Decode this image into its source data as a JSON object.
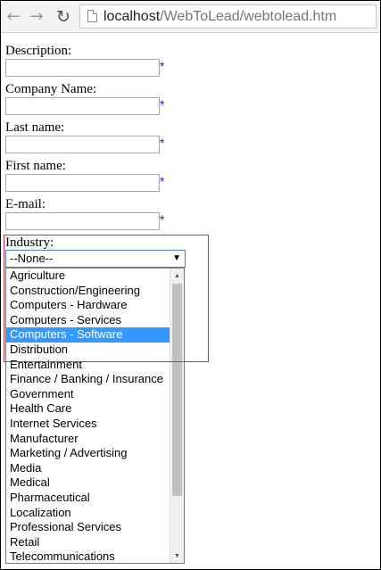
{
  "browser": {
    "icons": {
      "back": "arrow-left-icon",
      "forward": "arrow-right-icon",
      "reload": "reload-icon",
      "page": "page-icon"
    },
    "url_host": "localhost",
    "url_path": "/WebToLead/webtolead.htm"
  },
  "form": {
    "fields": [
      {
        "label": "Description:",
        "value": "",
        "required_mark": "*"
      },
      {
        "label": "Company Name:",
        "value": "",
        "required_mark": "*"
      },
      {
        "label": "Last name:",
        "value": "",
        "required_mark": "*"
      },
      {
        "label": "First name:",
        "value": "",
        "required_mark": "*"
      },
      {
        "label": "E-mail:",
        "value": "",
        "required_mark": "*"
      }
    ],
    "industry": {
      "label": "Industry:",
      "selected_value": "--None--",
      "highlighted_option": "Computers - Software",
      "options": [
        "Agriculture",
        "Construction/Engineering",
        "Computers - Hardware",
        "Computers - Services",
        "Computers - Software",
        "Distribution",
        "Entertainment",
        "Finance / Banking / Insurance",
        "Government",
        "Health Care",
        "Internet Services",
        "Manufacturer",
        "Marketing / Advertising",
        "Media",
        "Medical",
        "Pharmaceutical",
        "Localization",
        "Professional Services",
        "Retail",
        "Telecommunications"
      ]
    }
  },
  "colors": {
    "selection": "#3399ff",
    "required": "#1a1aff",
    "highlight_border": "#c8373a",
    "focus_border": "#4a7fd6"
  }
}
